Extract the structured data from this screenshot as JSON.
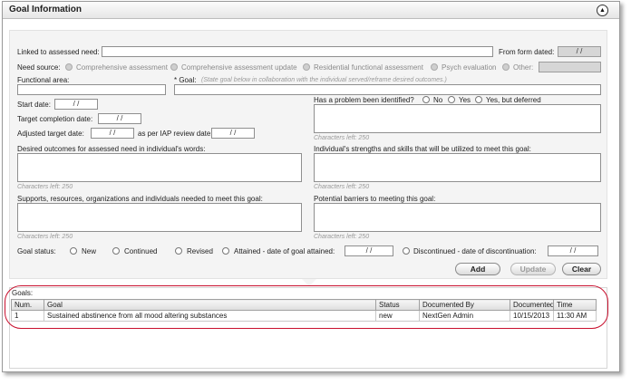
{
  "header": {
    "title": "Goal Information"
  },
  "form": {
    "linked_label": "Linked to assessed need:",
    "from_form_label": "From form dated:",
    "from_form_value": "/ /",
    "need_source_label": "Need source:",
    "need_sources": [
      "Comprehensive assessment",
      "Comprehensive assessment update",
      "Residential functional assessment",
      "Psych evaluation",
      "Other:"
    ],
    "functional_area_label": "Functional area:",
    "goal_label": "* Goal:",
    "goal_hint": "(State goal below in collaboration with the individual served/reframe desired outcomes.)",
    "start_date_label": "Start date:",
    "start_date_value": "/ /",
    "target_completion_label": "Target completion date:",
    "target_completion_value": "/ /",
    "adjusted_target_label": "Adjusted target date:",
    "adjusted_target_value": "/ /",
    "iap_review_label": "as per IAP review date:",
    "iap_review_value": "/ /",
    "problem_label": "Has a problem been identified?",
    "problem_options": [
      "No",
      "Yes",
      "Yes, but deferred"
    ],
    "chars_left": "Characters left: 250",
    "desired_outcomes_label": "Desired outcomes for assessed need in individual's words:",
    "strengths_label": "Individual's strengths and skills that will be utilized to meet this goal:",
    "supports_label": "Supports, resources, organizations and individuals needed to meet this goal:",
    "barriers_label": "Potential barriers to meeting this goal:",
    "goal_status_label": "Goal status:",
    "status_options": [
      "New",
      "Continued",
      "Revised",
      "Attained - date of goal attained:",
      "Discontinued - date of discontinuation:"
    ],
    "attained_date": "/ /",
    "discontinued_date": "/ /"
  },
  "buttons": {
    "add": "Add",
    "update": "Update",
    "clear": "Clear"
  },
  "goals": {
    "label": "Goals:",
    "columns": [
      "Num.",
      "Goal",
      "Status",
      "Documented By",
      "Documented",
      "Time"
    ],
    "rows": [
      {
        "num": "1",
        "goal": "Sustained abstinence from all mood altering substances",
        "status": "new",
        "documented_by": "NextGen Admin",
        "documented": "10/15/2013",
        "time": "11:30 AM"
      }
    ]
  },
  "colors": {
    "highlight": "#c8102e",
    "panel": "#f4f4f4"
  }
}
